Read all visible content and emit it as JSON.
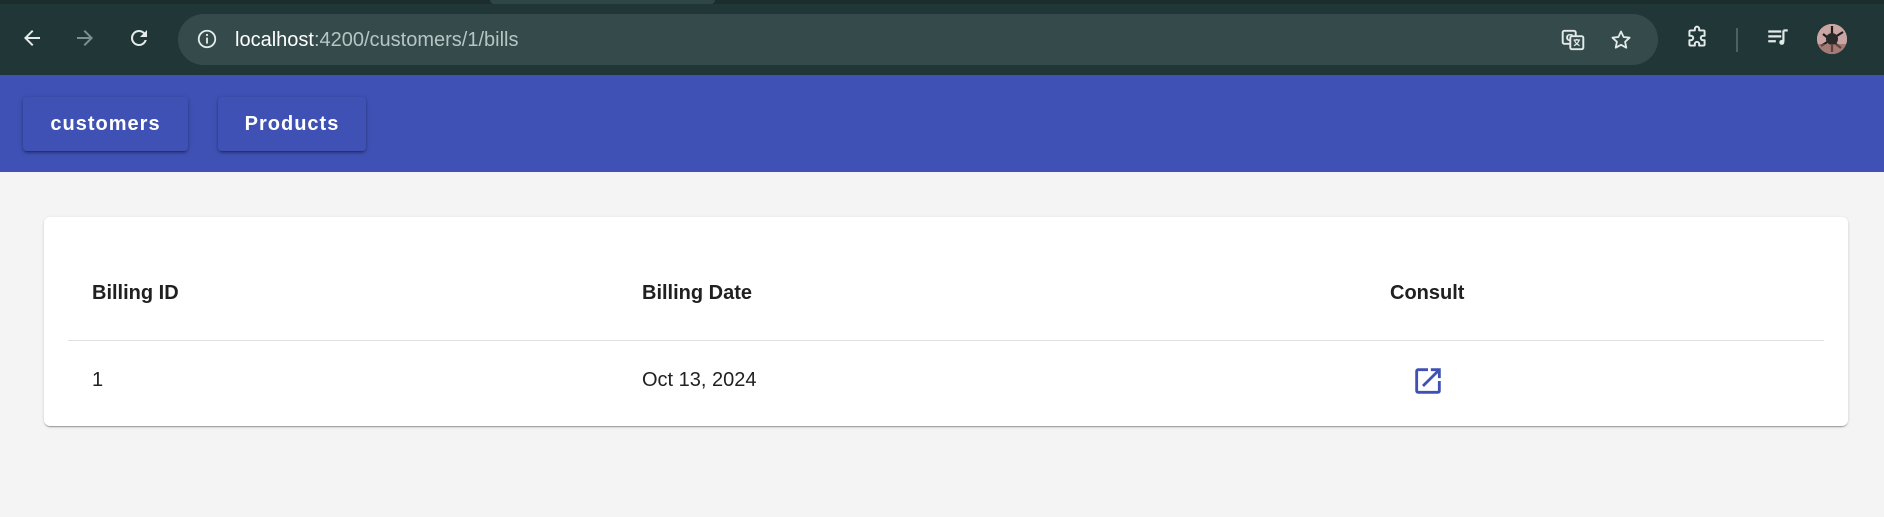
{
  "browser": {
    "url_host": "localhost",
    "url_path": ":4200/customers/1/bills",
    "icons": {
      "back": "back-arrow-icon",
      "forward": "forward-arrow-icon",
      "reload": "reload-icon",
      "site_info": "site-info-icon",
      "translate": "translate-icon",
      "bookmark": "star-icon",
      "extensions": "puzzle-icon",
      "media": "media-queue-icon",
      "profile": "avatar"
    },
    "colors": {
      "frame": "#213737",
      "omnibox": "#354b4b"
    }
  },
  "toolbar": {
    "background": "#3f51b5",
    "buttons": [
      {
        "label": "customers"
      },
      {
        "label": "Products"
      }
    ]
  },
  "table": {
    "columns": [
      "Billing ID",
      "Billing Date",
      "Consult"
    ],
    "rows": [
      {
        "id": "1",
        "date": "Oct 13, 2024",
        "consult_icon": "open-in-new-icon"
      }
    ]
  }
}
